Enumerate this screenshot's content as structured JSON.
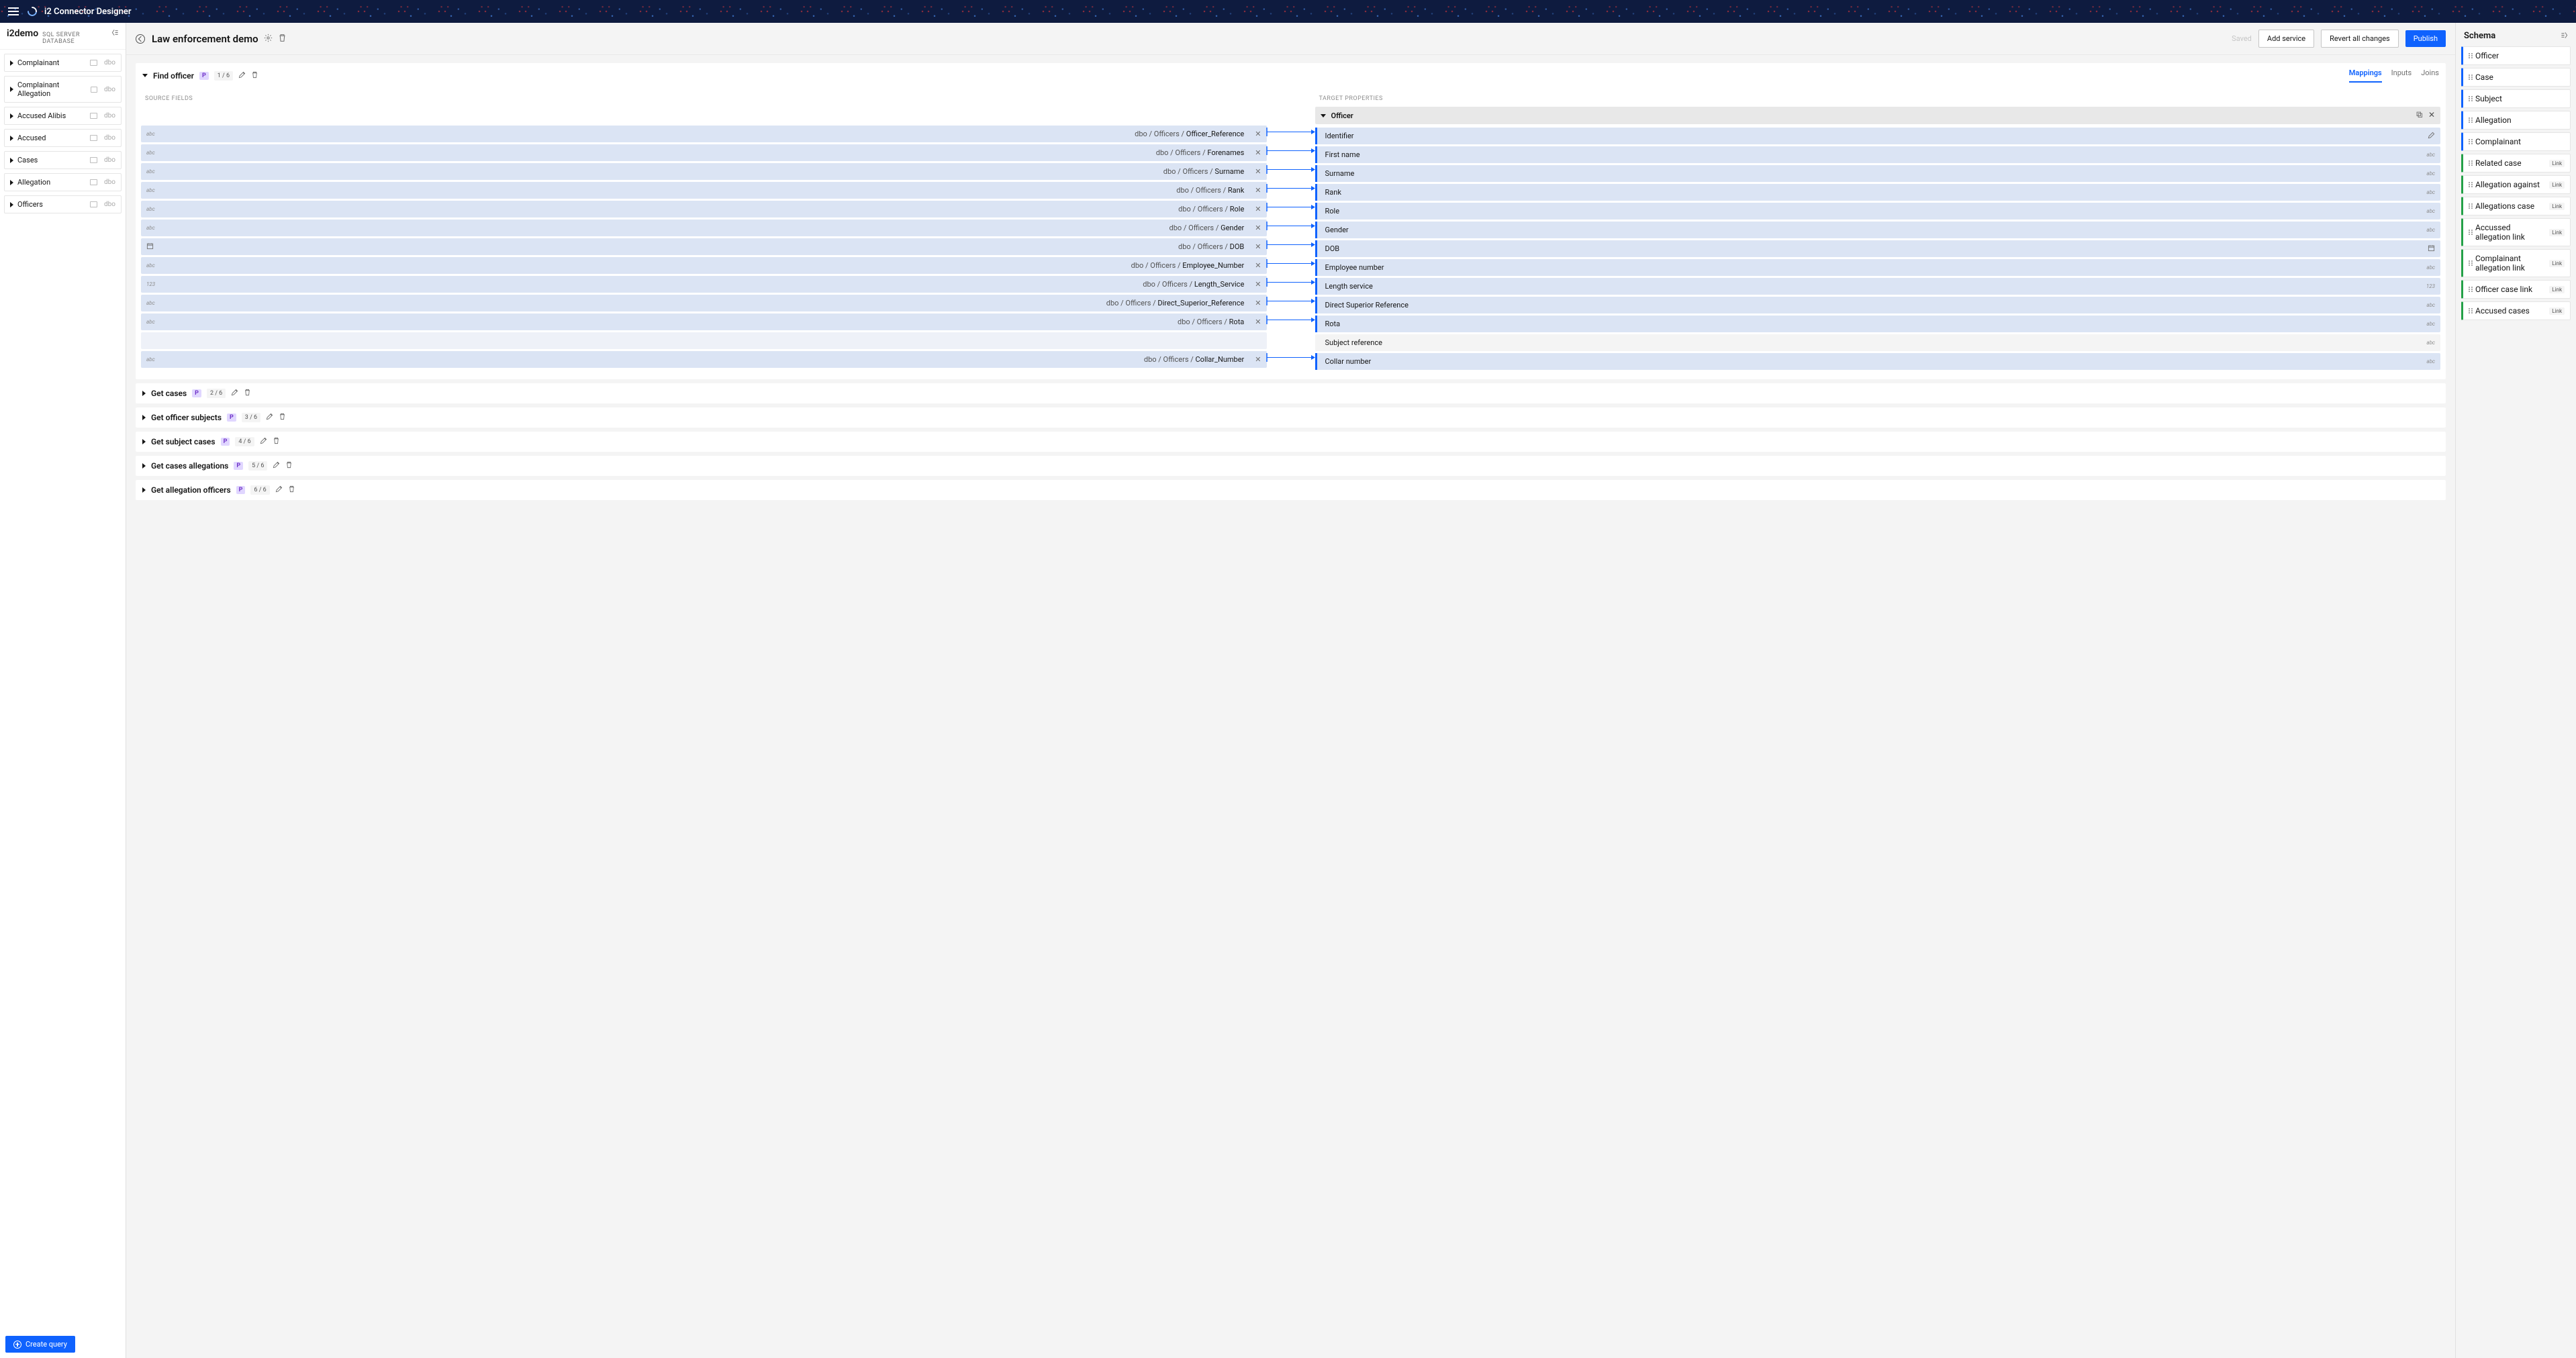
{
  "app": {
    "title": "i2 Connector Designer"
  },
  "db": {
    "name": "i2demo",
    "sub": "SQL SERVER DATABASE",
    "schema_label": "dbo"
  },
  "tables": [
    {
      "name": "Complainant"
    },
    {
      "name": "Complainant Allegation"
    },
    {
      "name": "Accused Alibis"
    },
    {
      "name": "Accused"
    },
    {
      "name": "Cases"
    },
    {
      "name": "Allegation"
    },
    {
      "name": "Officers"
    }
  ],
  "page": {
    "title": "Law enforcement demo",
    "saved": "Saved",
    "buttons": {
      "add_service": "Add service",
      "revert": "Revert all changes",
      "publish": "Publish"
    }
  },
  "tabs": {
    "mappings": "Mappings",
    "inputs": "Inputs",
    "joins": "Joins"
  },
  "section_headers": {
    "source": "SOURCE FIELDS",
    "target": "TARGET PROPERTIES"
  },
  "target_entity": "Officer",
  "queries": [
    {
      "title": "Find officer",
      "badge": "P",
      "count": "1 / 6",
      "expanded": true
    },
    {
      "title": "Get cases",
      "badge": "P",
      "count": "2 / 6",
      "expanded": false
    },
    {
      "title": "Get officer subjects",
      "badge": "P",
      "count": "3 / 6",
      "expanded": false
    },
    {
      "title": "Get subject cases",
      "badge": "P",
      "count": "4 / 6",
      "expanded": false
    },
    {
      "title": "Get cases allegations",
      "badge": "P",
      "count": "5 / 6",
      "expanded": false
    },
    {
      "title": "Get allegation officers",
      "badge": "P",
      "count": "6 / 6",
      "expanded": false
    }
  ],
  "rows": [
    {
      "type_s": "abc",
      "path": "dbo / Officers /",
      "field": "Officer_Reference",
      "mapped": true,
      "tgt": "Identifier",
      "type_t": "edit"
    },
    {
      "type_s": "abc",
      "path": "dbo / Officers /",
      "field": "Forenames",
      "mapped": true,
      "tgt": "First name",
      "type_t": "abc"
    },
    {
      "type_s": "abc",
      "path": "dbo / Officers /",
      "field": "Surname",
      "mapped": true,
      "tgt": "Surname",
      "type_t": "abc"
    },
    {
      "type_s": "abc",
      "path": "dbo / Officers /",
      "field": "Rank",
      "mapped": true,
      "tgt": "Rank",
      "type_t": "abc"
    },
    {
      "type_s": "abc",
      "path": "dbo / Officers /",
      "field": "Role",
      "mapped": true,
      "tgt": "Role",
      "type_t": "abc"
    },
    {
      "type_s": "abc",
      "path": "dbo / Officers /",
      "field": "Gender",
      "mapped": true,
      "tgt": "Gender",
      "type_t": "abc"
    },
    {
      "type_s": "cal",
      "path": "dbo / Officers /",
      "field": "DOB",
      "mapped": true,
      "tgt": "DOB",
      "type_t": "cal"
    },
    {
      "type_s": "abc",
      "path": "dbo / Officers /",
      "field": "Employee_Number",
      "mapped": true,
      "tgt": "Employee number",
      "type_t": "abc"
    },
    {
      "type_s": "123",
      "path": "dbo / Officers /",
      "field": "Length_Service",
      "mapped": true,
      "tgt": "Length service",
      "type_t": "123"
    },
    {
      "type_s": "abc",
      "path": "dbo / Officers /",
      "field": "Direct_Superior_Reference",
      "mapped": true,
      "tgt": "Direct Superior Reference",
      "type_t": "abc"
    },
    {
      "type_s": "abc",
      "path": "dbo / Officers /",
      "field": "Rota",
      "mapped": true,
      "tgt": "Rota",
      "type_t": "abc"
    },
    {
      "type_s": "",
      "path": "",
      "field": "",
      "mapped": false,
      "tgt": "Subject reference",
      "type_t": "abc",
      "gap": true
    },
    {
      "type_s": "abc",
      "path": "dbo / Officers /",
      "field": "Collar_Number",
      "mapped": true,
      "tgt": "Collar number",
      "type_t": "abc"
    }
  ],
  "schema_title": "Schema",
  "schema": [
    {
      "name": "Officer",
      "link": false
    },
    {
      "name": "Case",
      "link": false
    },
    {
      "name": "Subject",
      "link": false
    },
    {
      "name": "Allegation",
      "link": false
    },
    {
      "name": "Complainant",
      "link": false
    },
    {
      "name": "Related case",
      "link": true
    },
    {
      "name": "Allegation against",
      "link": true
    },
    {
      "name": "Allegations case",
      "link": true
    },
    {
      "name": "Accussed allegation link",
      "link": true
    },
    {
      "name": "Complainant allegation link",
      "link": true
    },
    {
      "name": "Officer case link",
      "link": true
    },
    {
      "name": "Accused cases",
      "link": true
    }
  ],
  "link_badge": "Link",
  "create_query": "Create query"
}
